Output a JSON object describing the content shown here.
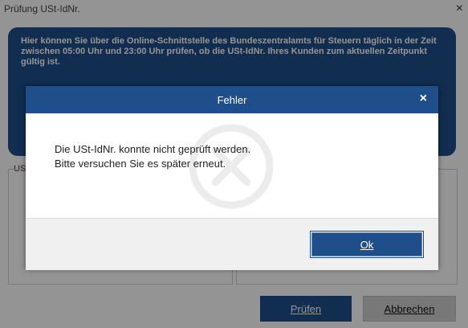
{
  "window": {
    "title": "Prüfung USt-IdNr.",
    "close_symbol": "×"
  },
  "info": {
    "paragraph1": "Hier können Sie über die Online-Schnittstelle des Bundeszentralamts für Steuern täglich in der Zeit zwischen 05:00 Uhr und 23:00 Uhr prüfen, ob die USt-IdNr. Ihres Kunden zum aktuellen Zeitpunkt gültig ist."
  },
  "panel": {
    "label_fragment": "US"
  },
  "buttons": {
    "pruefen": "Prüfen",
    "abbrechen": "Abbrechen"
  },
  "dialog": {
    "title": "Fehler",
    "close_symbol": "×",
    "message_line1": "Die USt-IdNr. konnte nicht geprüft werden.",
    "message_line2": "Bitte versuchen Sie es später erneut.",
    "ok_label": "Ok"
  },
  "colors": {
    "accent": "#1e4f8a",
    "overlay": "rgba(0,0,0,0.42)"
  },
  "icons": {
    "watermark": "error-circle-x-icon"
  }
}
